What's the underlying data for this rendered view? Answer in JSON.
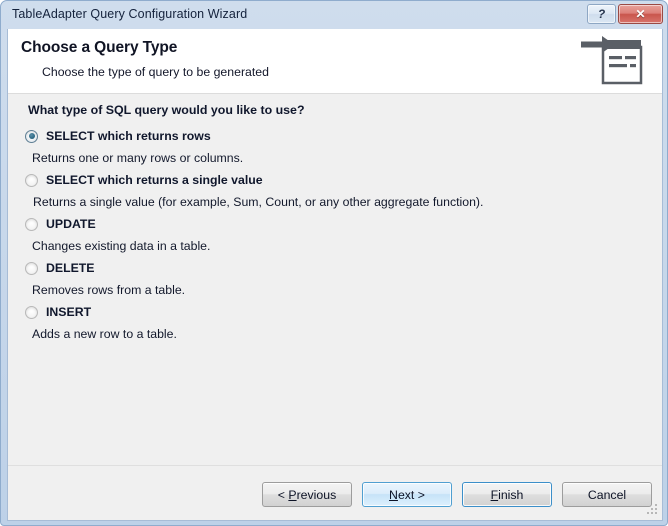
{
  "window": {
    "title": "TableAdapter Query Configuration Wizard",
    "help_button": "?",
    "close_button": "✕"
  },
  "banner": {
    "title": "Choose a Query Type",
    "subtitle": "Choose the type of query to be generated",
    "icon": "query-wizard-icon"
  },
  "main": {
    "question": "What type of SQL query would you like to use?",
    "options": [
      {
        "label": "SELECT which returns rows",
        "description": "Returns one or many rows or columns.",
        "selected": true
      },
      {
        "label": "SELECT which returns a single value",
        "description": "Returns a single value (for example, Sum, Count, or any other aggregate function).",
        "selected": false
      },
      {
        "label": "UPDATE",
        "description": "Changes existing data in a table.",
        "selected": false
      },
      {
        "label": "DELETE",
        "description": "Removes rows from a table.",
        "selected": false
      },
      {
        "label": "INSERT",
        "description": "Adds a new row to a table.",
        "selected": false
      }
    ]
  },
  "buttons": {
    "previous": {
      "prefix": "< ",
      "mnemonic": "P",
      "rest": "revious"
    },
    "next": {
      "prefix": "",
      "mnemonic": "N",
      "rest": "ext >"
    },
    "finish": {
      "prefix": "",
      "mnemonic": "F",
      "rest": "inish"
    },
    "cancel": {
      "prefix": "",
      "mnemonic": "",
      "rest": "Cancel"
    }
  },
  "colors": {
    "titlebar": "#c5d6ea",
    "body": "#f0f0f0",
    "banner": "#ffffff",
    "accent": "#3c8fc9",
    "radio_dot": "#2e6a86",
    "close": "#c9564d"
  }
}
